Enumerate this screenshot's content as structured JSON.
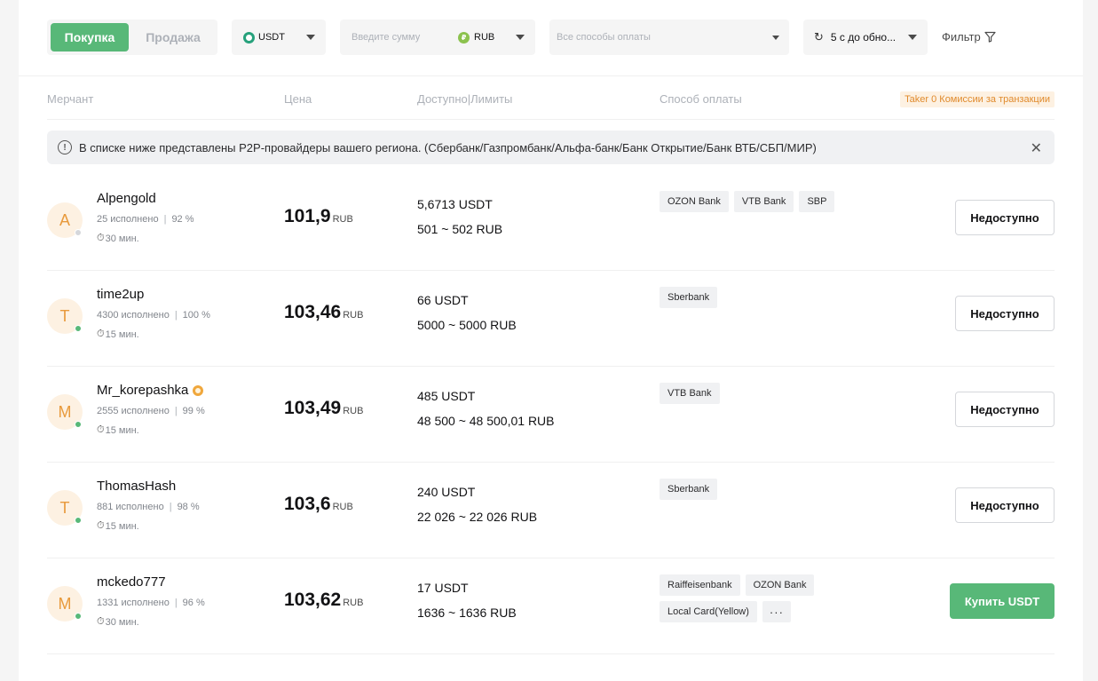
{
  "toolbar": {
    "buy_label": "Покупка",
    "sell_label": "Продажа",
    "coin": "USDT",
    "coin_icon": "tether-icon",
    "amount_placeholder": "Введите сумму",
    "fiat": "RUB",
    "fiat_icon": "ruble-icon",
    "fiat_icon_glyph": "₽",
    "payment_placeholder": "Все способы оплаты",
    "refresh_label": "5 с до обно...",
    "filter_label": "Фильтр",
    "accent_color": "#58b878"
  },
  "table_header": {
    "merchant": "Мерчант",
    "price": "Цена",
    "available": "Доступно|Лимиты",
    "payment": "Способ оплаты",
    "taker_note": "Taker 0 Комиссии за транзакции"
  },
  "notice": {
    "text": "В списке ниже представлены P2P-провайдеры вашего региона. (Сбербанк/Газпромбанк/Альфа-банк/Банк Открытие/Банк ВТБ/СБП/МИР)",
    "info_glyph": "!",
    "close_glyph": "✕"
  },
  "rows": [
    {
      "initial": "A",
      "name": "Alpengold",
      "orders": "25 исполнено",
      "completion": "92 %",
      "sep": "|",
      "time": "30 мин.",
      "price": "101,9",
      "currency": "RUB",
      "available": "5,6713 USDT",
      "limits": "501 ~ 502 RUB",
      "payments": [
        "OZON Bank",
        "VTB Bank",
        "SBP"
      ],
      "action": "Недоступно",
      "online": false
    },
    {
      "initial": "T",
      "name": "time2up",
      "orders": "4300 исполнено",
      "completion": "100 %",
      "sep": "|",
      "time": "15 мин.",
      "price": "103,46",
      "currency": "RUB",
      "available": "66 USDT",
      "limits": "5000 ~ 5000 RUB",
      "payments": [
        "Sberbank"
      ],
      "action": "Недоступно",
      "online": true
    },
    {
      "initial": "M",
      "name": "Mr_korepashka",
      "orders": "2555 исполнено",
      "completion": "99 %",
      "sep": "|",
      "time": "15 мин.",
      "price": "103,49",
      "currency": "RUB",
      "available": "485 USDT",
      "limits": "48 500 ~ 48 500,01 RUB",
      "payments": [
        "VTB Bank"
      ],
      "action": "Недоступно",
      "online": true,
      "verified": true
    },
    {
      "initial": "T",
      "name": "ThomasHash",
      "orders": "881 исполнено",
      "completion": "98 %",
      "sep": "|",
      "time": "15 мин.",
      "price": "103,6",
      "currency": "RUB",
      "available": "240 USDT",
      "limits": "22 026 ~ 22 026 RUB",
      "payments": [
        "Sberbank"
      ],
      "action": "Недоступно",
      "online": true
    },
    {
      "initial": "M",
      "name": "mckedo777",
      "orders": "1331 исполнено",
      "completion": "96 %",
      "sep": "|",
      "time": "30 мин.",
      "price": "103,62",
      "currency": "RUB",
      "available": "17 USDT",
      "limits": "1636 ~ 1636 RUB",
      "payments": [
        "Raiffeisenbank",
        "OZON Bank",
        "Local Card(Yellow)",
        "···"
      ],
      "action": "Купить USDT",
      "online": true,
      "buy_enabled": true
    }
  ]
}
